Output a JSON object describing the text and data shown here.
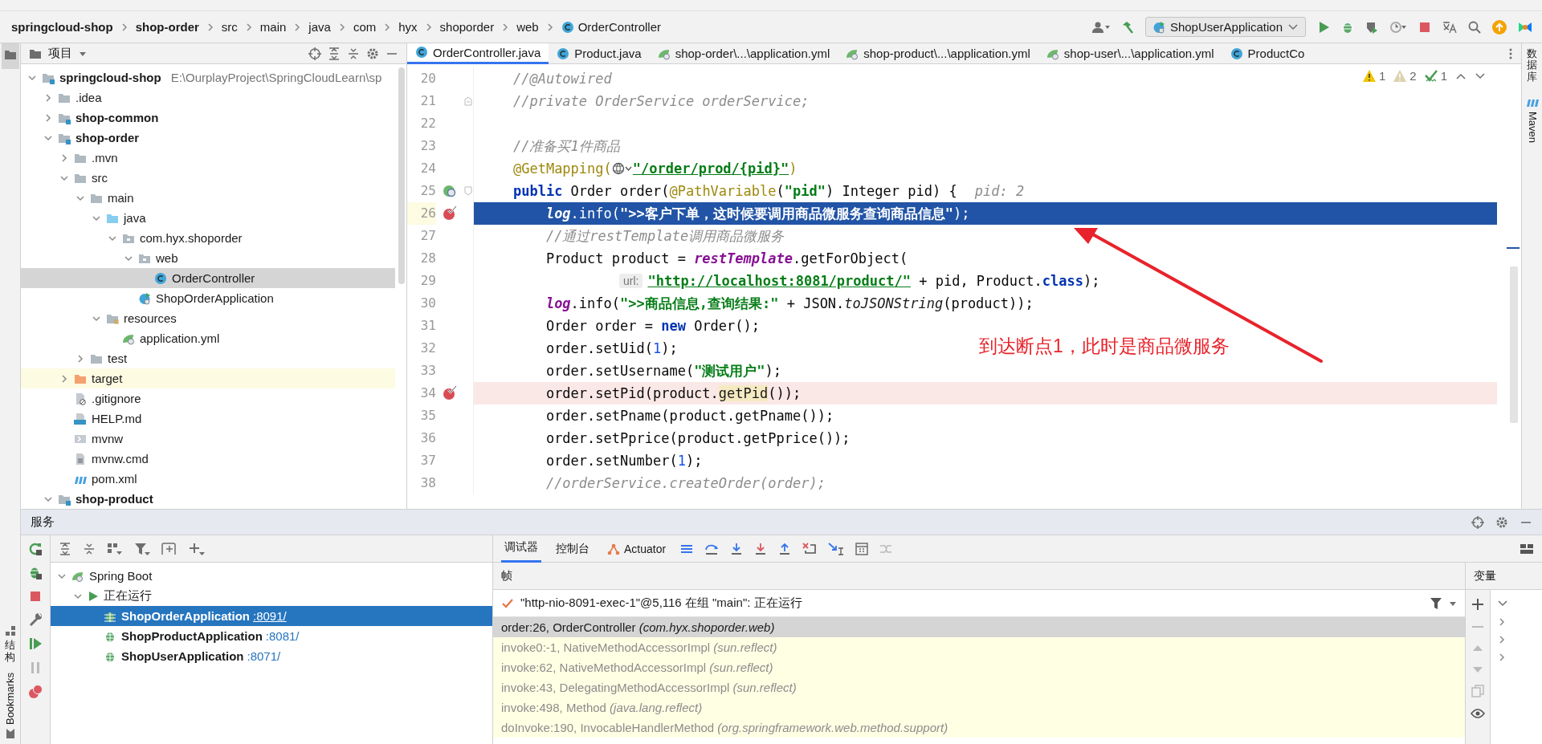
{
  "breadcrumbs": [
    {
      "label": "springcloud-shop",
      "kind": "module"
    },
    {
      "label": "shop-order",
      "kind": "module"
    },
    {
      "label": "src",
      "kind": "plain"
    },
    {
      "label": "main",
      "kind": "plain"
    },
    {
      "label": "java",
      "kind": "plain"
    },
    {
      "label": "com",
      "kind": "plain"
    },
    {
      "label": "hyx",
      "kind": "plain"
    },
    {
      "label": "shoporder",
      "kind": "plain"
    },
    {
      "label": "web",
      "kind": "plain"
    },
    {
      "label": "OrderController",
      "kind": "class"
    }
  ],
  "run_config": {
    "label": "ShopUserApplication"
  },
  "project": {
    "title": "项目",
    "tree": [
      {
        "label": "springcloud-shop",
        "kind": "module",
        "hint": "E:\\OurplayProject\\SpringCloudLearn\\sp",
        "expanded": true,
        "selected": false,
        "highlighted": false,
        "children": [
          {
            "label": ".idea",
            "kind": "folder",
            "expanded": false,
            "selected": false,
            "highlighted": false
          },
          {
            "label": "shop-common",
            "kind": "module",
            "expanded": false,
            "selected": false,
            "highlighted": false
          },
          {
            "label": "shop-order",
            "kind": "module",
            "expanded": true,
            "selected": false,
            "highlighted": false,
            "children": [
              {
                "label": ".mvn",
                "kind": "folder",
                "expanded": false,
                "selected": false,
                "highlighted": false
              },
              {
                "label": "src",
                "kind": "folder",
                "expanded": true,
                "selected": false,
                "highlighted": false,
                "children": [
                  {
                    "label": "main",
                    "kind": "folder",
                    "expanded": true,
                    "selected": false,
                    "highlighted": false,
                    "children": [
                      {
                        "label": "java",
                        "kind": "source-folder",
                        "expanded": true,
                        "selected": false,
                        "highlighted": false,
                        "children": [
                          {
                            "label": "com.hyx.shoporder",
                            "kind": "package",
                            "expanded": true,
                            "selected": false,
                            "highlighted": false,
                            "children": [
                              {
                                "label": "web",
                                "kind": "package",
                                "expanded": true,
                                "selected": false,
                                "highlighted": false,
                                "children": [
                                  {
                                    "label": "OrderController",
                                    "kind": "class",
                                    "selected": true,
                                    "highlighted": false
                                  }
                                ]
                              },
                              {
                                "label": "ShopOrderApplication",
                                "kind": "app-class",
                                "selected": false,
                                "highlighted": false
                              }
                            ]
                          }
                        ]
                      },
                      {
                        "label": "resources",
                        "kind": "resources",
                        "expanded": true,
                        "selected": false,
                        "highlighted": false,
                        "children": [
                          {
                            "label": "application.yml",
                            "kind": "yml",
                            "selected": false,
                            "highlighted": false
                          }
                        ]
                      }
                    ]
                  },
                  {
                    "label": "test",
                    "kind": "folder",
                    "expanded": false,
                    "selected": false,
                    "highlighted": false
                  }
                ]
              },
              {
                "label": "target",
                "kind": "excluded-folder",
                "expanded": false,
                "selected": false,
                "highlighted": true
              },
              {
                "label": ".gitignore",
                "kind": "ignore-file",
                "selected": false,
                "highlighted": false
              },
              {
                "label": "HELP.md",
                "kind": "markdown",
                "selected": false,
                "highlighted": false
              },
              {
                "label": "mvnw",
                "kind": "script",
                "selected": false,
                "highlighted": false
              },
              {
                "label": "mvnw.cmd",
                "kind": "text-file",
                "selected": false,
                "highlighted": false
              },
              {
                "label": "pom.xml",
                "kind": "maven",
                "selected": false,
                "highlighted": false
              }
            ]
          },
          {
            "label": "shop-product",
            "kind": "module",
            "expanded": true,
            "selected": false,
            "highlighted": false
          }
        ]
      }
    ]
  },
  "editor_tabs": [
    {
      "label": "OrderController.java",
      "kind": "class",
      "selected": true
    },
    {
      "label": "Product.java",
      "kind": "class",
      "selected": false
    },
    {
      "label": "shop-order\\...\\application.yml",
      "kind": "yml",
      "selected": false
    },
    {
      "label": "shop-product\\...\\application.yml",
      "kind": "yml",
      "selected": false
    },
    {
      "label": "shop-user\\...\\application.yml",
      "kind": "yml",
      "selected": false
    },
    {
      "label": "ProductCo",
      "kind": "class",
      "selected": false
    }
  ],
  "inspections": [
    {
      "kind": "warning",
      "count": "1"
    },
    {
      "kind": "weak-warning",
      "count": "2"
    },
    {
      "kind": "typo",
      "count": "1"
    }
  ],
  "lines": [
    {
      "number": "20",
      "kind": "plain",
      "breakpoint": false,
      "current": false,
      "segments": [
        {
          "kind": "comment",
          "text": "    //@Autowired"
        }
      ]
    },
    {
      "number": "21",
      "kind": "fold-end",
      "breakpoint": false,
      "current": false,
      "segments": [
        {
          "kind": "comment",
          "text": "    //private OrderService orderService;"
        }
      ]
    },
    {
      "number": "22",
      "kind": "plain",
      "breakpoint": false,
      "current": false
    },
    {
      "number": "23",
      "breakpoint": false,
      "current": false,
      "segments": [
        {
          "kind": "comment",
          "text": "    //准备买1件商品"
        }
      ]
    },
    {
      "number": "24",
      "breakpoint": false,
      "current": false,
      "segments": [
        {
          "kind": "annotation",
          "text": "    @GetMapping("
        },
        {
          "kind": "route-icon"
        },
        {
          "kind": "link",
          "text": "\"/order/prod/{pid}\""
        },
        {
          "kind": "annotation",
          "text": ")"
        }
      ]
    },
    {
      "number": "25",
      "kind": "method-start",
      "breakpoint": false,
      "current": false,
      "segments": [
        {
          "kind": "keyword",
          "text": "    public"
        },
        {
          "kind": "plain",
          "text": " Order order("
        },
        {
          "kind": "annotation",
          "text": "@PathVariable"
        },
        {
          "kind": "plain",
          "text": "("
        },
        {
          "kind": "string",
          "text": "\"pid\""
        },
        {
          "kind": "plain",
          "text": ") Integer pid) {"
        },
        {
          "kind": "inlay",
          "text": "pid: 2"
        }
      ]
    },
    {
      "number": "26",
      "breakpoint": true,
      "current": true,
      "segments": [
        {
          "kind": "field",
          "text": "        log"
        },
        {
          "kind": "plain",
          "text": ".info("
        },
        {
          "kind": "string",
          "text": "\">>客户下单，这时候要调用商品微服务查询商品信息\""
        },
        {
          "kind": "plain",
          "text": ");"
        }
      ]
    },
    {
      "number": "27",
      "breakpoint": false,
      "current": false,
      "segments": [
        {
          "kind": "comment",
          "text": "        //通过restTemplate调用商品微服务"
        }
      ]
    },
    {
      "number": "28",
      "breakpoint": false,
      "current": false,
      "segments": [
        {
          "kind": "plain",
          "text": "        Product product = "
        },
        {
          "kind": "field",
          "text": "restTemplate"
        },
        {
          "kind": "plain",
          "text": ".getForObject("
        }
      ]
    },
    {
      "number": "29",
      "breakpoint": false,
      "current": false,
      "segments": [
        {
          "kind": "hint",
          "text": "url:"
        },
        {
          "kind": "link",
          "text": "\"http://localhost:8081/product/\""
        },
        {
          "kind": "plain",
          "text": " + pid, Product."
        },
        {
          "kind": "keyword",
          "text": "class"
        },
        {
          "kind": "plain",
          "text": ");"
        }
      ]
    },
    {
      "number": "30",
      "breakpoint": false,
      "current": false,
      "segments": [
        {
          "kind": "field",
          "text": "        log"
        },
        {
          "kind": "plain",
          "text": ".info("
        },
        {
          "kind": "string",
          "text": "\">>商品信息,查询结果:\""
        },
        {
          "kind": "plain",
          "text": " + JSON."
        },
        {
          "kind": "static",
          "text": "toJSONString"
        },
        {
          "kind": "plain",
          "text": "(product));"
        }
      ]
    },
    {
      "number": "31",
      "breakpoint": false,
      "current": false,
      "segments": [
        {
          "kind": "plain",
          "text": "        Order order = "
        },
        {
          "kind": "keyword",
          "text": "new"
        },
        {
          "kind": "plain",
          "text": " Order();"
        }
      ]
    },
    {
      "number": "32",
      "breakpoint": false,
      "current": false,
      "segments": [
        {
          "kind": "plain",
          "text": "        order.setUid("
        },
        {
          "kind": "number",
          "text": "1"
        },
        {
          "kind": "plain",
          "text": ");"
        }
      ]
    },
    {
      "number": "33",
      "breakpoint": false,
      "current": false,
      "segments": [
        {
          "kind": "plain",
          "text": "        order.setUsername("
        },
        {
          "kind": "string",
          "text": "\"测试用户\""
        },
        {
          "kind": "plain",
          "text": ");"
        }
      ]
    },
    {
      "number": "34",
      "breakpoint": true,
      "current": false,
      "segments": [
        {
          "kind": "plain",
          "text": "        order.setPid(product."
        },
        {
          "kind": "usage",
          "text": "getPid"
        },
        {
          "kind": "plain",
          "text": "());"
        }
      ]
    },
    {
      "number": "35",
      "breakpoint": false,
      "current": false,
      "segments": [
        {
          "kind": "plain",
          "text": "        order.setPname(product.getPname());"
        }
      ]
    },
    {
      "number": "36",
      "breakpoint": false,
      "current": false,
      "segments": [
        {
          "kind": "plain",
          "text": "        order.setPprice(product.getPprice());"
        }
      ]
    },
    {
      "number": "37",
      "breakpoint": false,
      "current": false,
      "segments": [
        {
          "kind": "plain",
          "text": "        order.setNumber("
        },
        {
          "kind": "number",
          "text": "1"
        },
        {
          "kind": "plain",
          "text": ");"
        }
      ]
    },
    {
      "number": "38",
      "breakpoint": false,
      "current": false,
      "segments": [
        {
          "kind": "comment",
          "text": "        //orderService.createOrder(order);"
        }
      ]
    }
  ],
  "callout": {
    "text": "到达断点1，此时是商品微服务"
  },
  "left_stripe": [
    {
      "label": "结构",
      "kind": "structure"
    },
    {
      "label": "Bookmarks",
      "kind": "bookmarks"
    }
  ],
  "right_stripe": [
    {
      "label": "数据库",
      "kind": "text"
    },
    {
      "label": "Maven",
      "kind": "maven"
    }
  ],
  "services": {
    "title": "服务",
    "tree": [
      {
        "label": "Spring Boot",
        "kind": "spring",
        "expanded": true,
        "selected": false,
        "children": [
          {
            "label": "正在运行",
            "kind": "running",
            "expanded": true,
            "selected": false,
            "children": [
              {
                "label": "ShopOrderApplication",
                "port": ":8091/",
                "kind": "app",
                "selected": true
              },
              {
                "label": "ShopProductApplication",
                "port": ":8081/",
                "kind": "app",
                "selected": false
              },
              {
                "label": "ShopUserApplication",
                "port": ":8071/",
                "kind": "app",
                "selected": false
              }
            ]
          }
        ]
      }
    ]
  },
  "debugger": {
    "tabs": [
      {
        "label": "调试器",
        "kind": "text",
        "selected": true
      },
      {
        "label": "控制台",
        "kind": "text",
        "selected": false
      },
      {
        "label": "Actuator",
        "kind": "actuator",
        "selected": false
      }
    ],
    "frames_title": "帧",
    "variables_title": "变量",
    "thread": "\"http-nio-8091-exec-1\"@5,116 在组 \"main\": 正在运行",
    "frames": [
      {
        "method": "order:26, OrderController",
        "package": "(com.hyx.shoporder.web)",
        "selected": true,
        "library": false
      },
      {
        "method": "invoke0:-1, NativeMethodAccessorImpl",
        "package": "(sun.reflect)",
        "selected": false,
        "library": true
      },
      {
        "method": "invoke:62, NativeMethodAccessorImpl",
        "package": "(sun.reflect)",
        "selected": false,
        "library": true
      },
      {
        "method": "invoke:43, DelegatingMethodAccessorImpl",
        "package": "(sun.reflect)",
        "selected": false,
        "library": true
      },
      {
        "method": "invoke:498, Method",
        "package": "(java.lang.reflect)",
        "selected": false,
        "library": true
      },
      {
        "method": "doInvoke:190, InvocableHandlerMethod",
        "package": "(org.springframework.web.method.support)",
        "selected": false,
        "library": true
      }
    ]
  }
}
